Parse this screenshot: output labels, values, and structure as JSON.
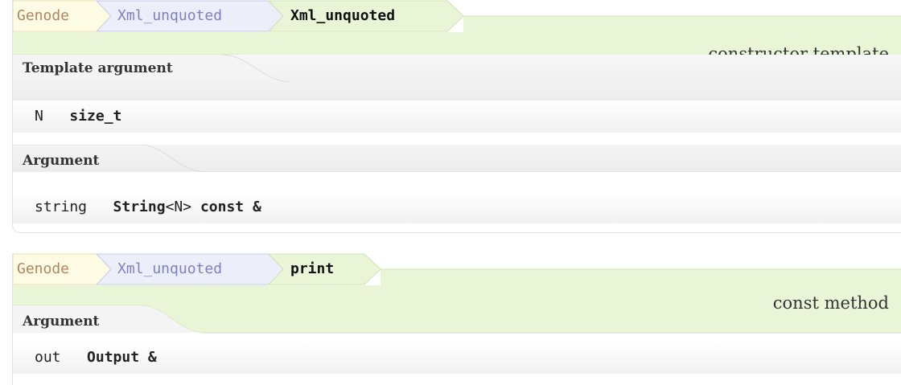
{
  "constructor_block": {
    "breadcrumb": {
      "namespace": "Genode",
      "class": "Xml_unquoted",
      "current": "Xml_unquoted"
    },
    "kind": "constructor template",
    "template_section": {
      "label": "Template argument",
      "params": [
        {
          "name": "N",
          "type": "size_t"
        }
      ]
    },
    "argument_section": {
      "label": "Argument",
      "params": [
        {
          "name": "string",
          "type_strong": "String",
          "type_plain": "<N>",
          "type_suffix": "const &"
        }
      ]
    }
  },
  "print_block": {
    "breadcrumb": {
      "namespace": "Genode",
      "class": "Xml_unquoted",
      "current": "print"
    },
    "kind": "const method",
    "argument_section": {
      "label": "Argument",
      "params": [
        {
          "name": "out",
          "type": "Output &"
        }
      ]
    }
  },
  "colors": {
    "ns_fill": "#fdfbe4",
    "class_fill": "#eceef9",
    "current_fill": "#eaf5d8",
    "border": "#cfe2b4"
  }
}
